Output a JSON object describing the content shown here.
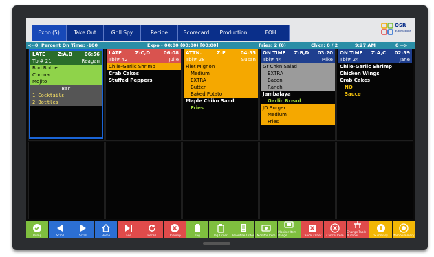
{
  "tabs": [
    {
      "label": "Expo (5)"
    },
    {
      "label": "Take Out"
    },
    {
      "label": "Grill Spy"
    },
    {
      "label": "Recipe"
    },
    {
      "label": "Scorecard"
    },
    {
      "label": "Production"
    },
    {
      "label": "FOH"
    }
  ],
  "logo": {
    "text": "QSR",
    "sub": "automations"
  },
  "status": {
    "left": "<--0",
    "percent": "Percent On Time: -100",
    "expo": "Expo - 00:00 (00:00) [00:00]",
    "fries": "Fries: 2  (0)",
    "chkn": "Chkn: 0 / 2",
    "time": "9:27 AM",
    "right": "0 -->"
  },
  "orders": [
    {
      "status": "LATE",
      "seat": "Z:A,B",
      "timer": "06:56",
      "table": "Tbl# 21",
      "server": "Reagan",
      "items": [
        {
          "text": "Bud Bottle"
        },
        {
          "text": "Corona"
        },
        {
          "text": "Mojito"
        },
        {
          "text": "Bar"
        },
        {
          "text": "1 Cocktails"
        },
        {
          "text": "2 Bottles"
        }
      ]
    },
    {
      "status": "LATE",
      "seat": "Z:C,D",
      "timer": "06:08",
      "table": "Tbl# 42",
      "server": "Julie",
      "items": [
        {
          "text": "Chile-Garlic Shrimp"
        },
        {
          "text": "Crab Cakes"
        },
        {
          "text": "Stuffed Peppers"
        }
      ]
    },
    {
      "status": "ATTN.",
      "seat": "Z:E",
      "timer": "04:35",
      "table": "Tbl# 28",
      "server": "Susan",
      "items": [
        {
          "text": "Filet Mignon"
        },
        {
          "text": "Medium"
        },
        {
          "text": "EXTRA"
        },
        {
          "text": "Butter"
        },
        {
          "text": "Baked Potato"
        },
        {
          "text": "Maple Chikn Sand"
        },
        {
          "text": "Fries"
        }
      ]
    },
    {
      "status": "ON TIME",
      "seat": "Z:B,D",
      "timer": "03:20",
      "table": "Tbl# 44",
      "server": "Mike",
      "items": [
        {
          "text": "Gr Chkn Salad"
        },
        {
          "text": "EXTRA"
        },
        {
          "text": "Bacon"
        },
        {
          "text": "Ranch"
        },
        {
          "text": "Jambalaya"
        },
        {
          "text": "Garlic Bread"
        },
        {
          "text": "JD Burger"
        },
        {
          "text": "Medium"
        },
        {
          "text": "Fries"
        }
      ]
    },
    {
      "status": "ON TIME",
      "seat": "Z:A,C",
      "timer": "02:39",
      "table": "Tbl# 24",
      "server": "Jane",
      "items": [
        {
          "text": "Chile-Garlic Shrimp"
        },
        {
          "text": "Chicken Wings"
        },
        {
          "text": "Crab Cakes"
        },
        {
          "text": "NO"
        },
        {
          "text": "Sauce"
        }
      ]
    }
  ],
  "buttons": [
    {
      "label": "Bump",
      "icon": "check-icon"
    },
    {
      "label": "Scroll",
      "icon": "arrow-left-icon"
    },
    {
      "label": "Scroll",
      "icon": "arrow-right-icon"
    },
    {
      "label": "Home",
      "icon": "home-icon"
    },
    {
      "label": "End",
      "icon": "skip-end-icon"
    },
    {
      "label": "Recall",
      "icon": "recall-icon"
    },
    {
      "label": "Unbump",
      "icon": "unbump-icon"
    },
    {
      "label": "Tag",
      "icon": "tag-icon"
    },
    {
      "label": "Tag Order",
      "icon": "tag-order-icon"
    },
    {
      "label": "Prioritize Order",
      "icon": "prioritize-icon"
    },
    {
      "label": "Monitor Item",
      "icon": "monitor-item-icon"
    },
    {
      "label": "Monitor Item Range",
      "icon": "monitor-range-icon"
    },
    {
      "label": "Cancel Order",
      "icon": "cancel-order-icon"
    },
    {
      "label": "Cancel Item",
      "icon": "cancel-item-icon"
    },
    {
      "label": "Change Table Number",
      "icon": "change-table-icon"
    },
    {
      "label": "Summary",
      "icon": "summary-icon"
    },
    {
      "label": "Item Summary",
      "icon": "item-summary-icon"
    }
  ]
}
